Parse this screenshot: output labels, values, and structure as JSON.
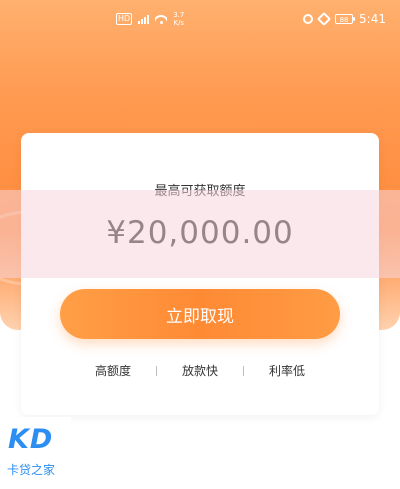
{
  "status_bar": {
    "network_badge": "HD",
    "speed_top": "3.7",
    "speed_bottom": "K/s",
    "battery": "88",
    "time": "5:41"
  },
  "card": {
    "label": "最高可获取额度",
    "amount": "¥20,000.00",
    "button_label": "立即取现",
    "features": [
      {
        "label": "高额度"
      },
      {
        "label": "放款快"
      },
      {
        "label": "利率低"
      }
    ]
  },
  "logo": {
    "mark": "KD",
    "text": "卡贷之家"
  }
}
